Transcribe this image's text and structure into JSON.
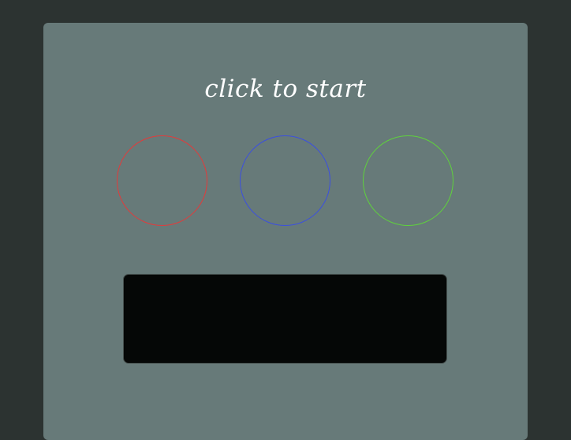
{
  "game": {
    "title": "click to start"
  },
  "circles": [
    {
      "name": "red",
      "color": "#e23b3b"
    },
    {
      "name": "blue",
      "color": "#3b4fe0"
    },
    {
      "name": "green",
      "color": "#5fd23c"
    }
  ],
  "display": {
    "text": ""
  }
}
